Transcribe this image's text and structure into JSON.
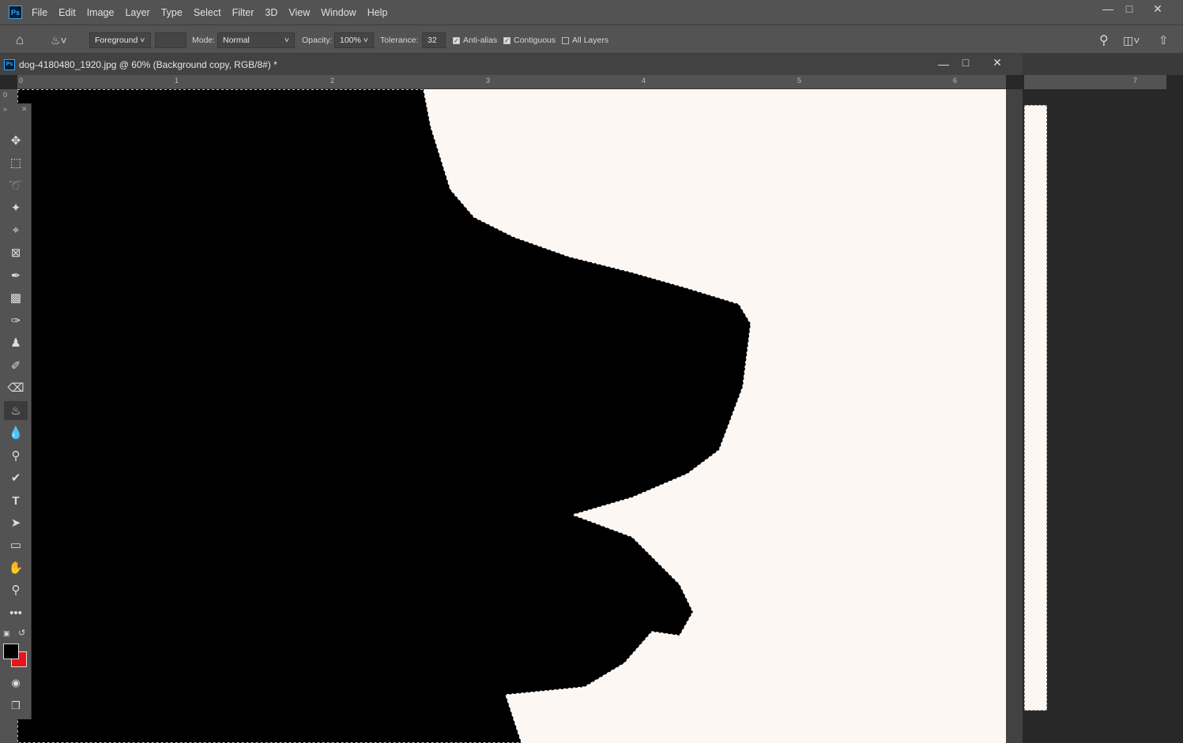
{
  "app": {
    "logo": "Ps",
    "menu": [
      "File",
      "Edit",
      "Image",
      "Layer",
      "Type",
      "Select",
      "Filter",
      "3D",
      "View",
      "Window",
      "Help"
    ]
  },
  "options": {
    "fill_source": "Foreground",
    "mode_label": "Mode:",
    "mode": "Normal",
    "opacity_label": "Opacity:",
    "opacity": "100%",
    "tolerance_label": "Tolerance:",
    "tolerance": "32",
    "anti_alias": {
      "label": "Anti-alias",
      "checked": true
    },
    "contiguous": {
      "label": "Contiguous",
      "checked": true
    },
    "all_layers": {
      "label": "All Layers",
      "checked": false
    }
  },
  "document": {
    "title": "dog-4180480_1920.jpg @ 60% (Background copy, RGB/8#) *",
    "ruler_labels": [
      "0",
      "1",
      "2",
      "3",
      "4",
      "5",
      "6"
    ],
    "ruler2_labels": [
      "7"
    ],
    "vruler_label": "0"
  },
  "tools": [
    {
      "name": "move"
    },
    {
      "name": "marquee"
    },
    {
      "name": "lasso"
    },
    {
      "name": "magic-wand"
    },
    {
      "name": "crop"
    },
    {
      "name": "frame"
    },
    {
      "name": "eyedropper"
    },
    {
      "name": "healing-brush"
    },
    {
      "name": "brush"
    },
    {
      "name": "clone-stamp"
    },
    {
      "name": "history-brush"
    },
    {
      "name": "eraser"
    },
    {
      "name": "paint-bucket",
      "active": true
    },
    {
      "name": "blur"
    },
    {
      "name": "dodge"
    },
    {
      "name": "pen"
    },
    {
      "name": "type"
    },
    {
      "name": "path-selection"
    },
    {
      "name": "rectangle"
    },
    {
      "name": "hand"
    },
    {
      "name": "zoom"
    },
    {
      "name": "more"
    }
  ],
  "colors": {
    "foreground": "#000000",
    "background": "#e8141b",
    "canvas": "#fdf7f4"
  }
}
